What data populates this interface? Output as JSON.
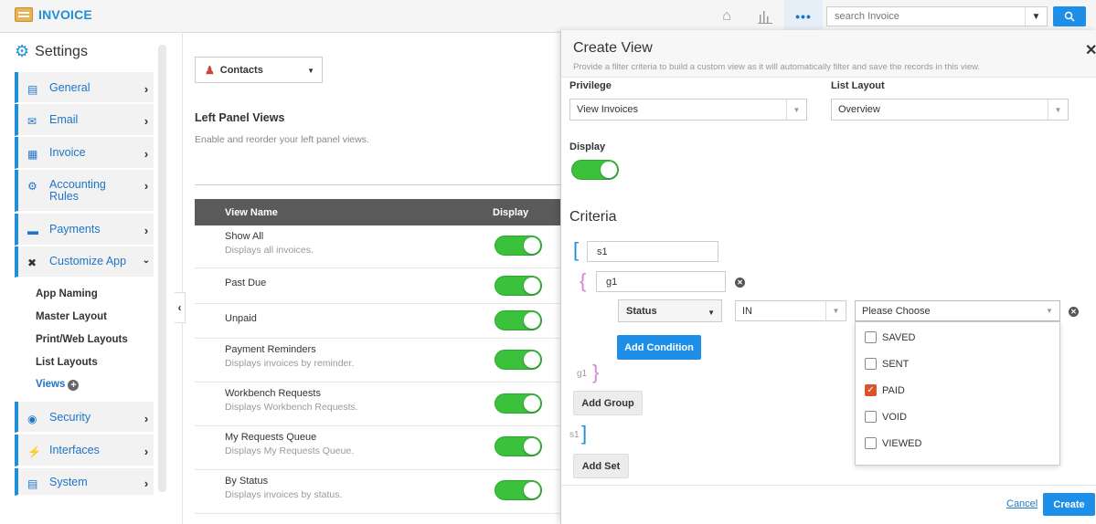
{
  "topbar": {
    "brand": "INVOICE",
    "search_placeholder": "search Invoice",
    "dots": "•••"
  },
  "sidebar": {
    "title": "Settings",
    "items": [
      {
        "label": "General",
        "icon": "monitor-icon"
      },
      {
        "label": "Email",
        "icon": "envelope-icon"
      },
      {
        "label": "Invoice",
        "icon": "invoice-icon"
      },
      {
        "label": "Accounting Rules",
        "icon": "cogs-icon"
      },
      {
        "label": "Payments",
        "icon": "credit-card-icon"
      },
      {
        "label": "Customize App",
        "icon": "tools-icon"
      },
      {
        "label": "Security",
        "icon": "lock-icon"
      },
      {
        "label": "Interfaces",
        "icon": "plug-icon"
      },
      {
        "label": "System",
        "icon": "system-icon"
      }
    ],
    "subitems": [
      "App Naming",
      "Master Layout",
      "Print/Web Layouts",
      "List Layouts",
      "Views"
    ]
  },
  "content": {
    "module_select": "Contacts",
    "section_title": "Left Panel Views",
    "section_desc": "Enable and reorder your left panel views.",
    "table_headers": {
      "name": "View Name",
      "display": "Display"
    },
    "rows": [
      {
        "name": "Show All",
        "desc": "Displays all invoices.",
        "display": true
      },
      {
        "name": "Past Due",
        "desc": "",
        "display": true
      },
      {
        "name": "Unpaid",
        "desc": "",
        "display": true
      },
      {
        "name": "Payment Reminders",
        "desc": "Displays invoices by reminder.",
        "display": true
      },
      {
        "name": "Workbench Requests",
        "desc": "Displays Workbench Requests.",
        "display": true
      },
      {
        "name": "My Requests Queue",
        "desc": "Displays My Requests Queue.",
        "display": true
      },
      {
        "name": "By Status",
        "desc": "Displays invoices by status.",
        "display": true
      }
    ]
  },
  "modal": {
    "title": "Create View",
    "subtitle": "Provide a filter criteria to build a custom view as it will automatically filter and save the records in this view.",
    "privilege_label": "Privilege",
    "privilege_value": "View Invoices",
    "list_layout_label": "List Layout",
    "list_layout_value": "Overview",
    "display_label": "Display",
    "display_on": true,
    "criteria_title": "Criteria",
    "set_name": "s1",
    "group_name": "g1",
    "condition_field": "Status",
    "condition_operator": "IN",
    "condition_value_placeholder": "Please Choose",
    "options": [
      {
        "label": "SAVED",
        "checked": false
      },
      {
        "label": "SENT",
        "checked": false
      },
      {
        "label": "PAID",
        "checked": true
      },
      {
        "label": "VOID",
        "checked": false
      },
      {
        "label": "VIEWED",
        "checked": false
      }
    ],
    "add_condition": "Add Condition",
    "group_end_label": "g1",
    "add_group": "Add Group",
    "set_end_label": "s1",
    "add_set": "Add Set",
    "cancel": "Cancel",
    "create": "Create"
  }
}
